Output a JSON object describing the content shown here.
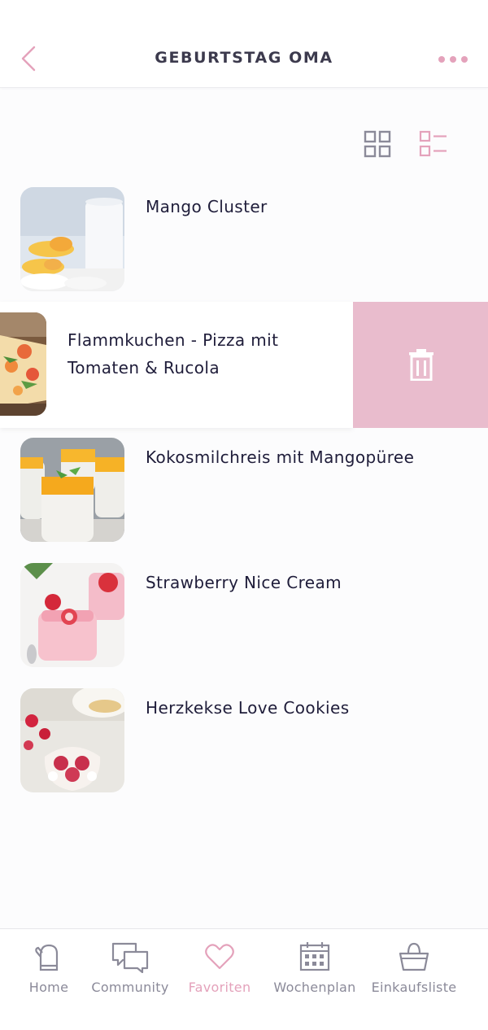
{
  "header": {
    "title": "GEBURTSTAG OMA"
  },
  "view_toggle": {
    "active": "list"
  },
  "recipes": [
    {
      "title": "Mango Cluster"
    },
    {
      "title_line1": "Flammkuchen - Pizza mit",
      "title_line2": "Tomaten & Rucola",
      "swiped": true
    },
    {
      "title": "Kokosmilchreis mit Mangopüree"
    },
    {
      "title": "Strawberry Nice Cream"
    },
    {
      "title": "Herzkekse Love Cookies"
    }
  ],
  "tabs": [
    {
      "label": "Home",
      "icon": "oven-mitt-icon"
    },
    {
      "label": "Community",
      "icon": "chat-bubbles-icon"
    },
    {
      "label": "Favoriten",
      "icon": "heart-icon",
      "active": true
    },
    {
      "label": "Wochenplan",
      "icon": "calendar-icon"
    },
    {
      "label": "Einkaufsliste",
      "icon": "basket-icon"
    }
  ],
  "colors": {
    "accent_pink": "#e4a2bb",
    "delete_bg": "#e9bccd",
    "text_dark": "#1f1d3a",
    "icon_gray": "#8b8a99"
  }
}
